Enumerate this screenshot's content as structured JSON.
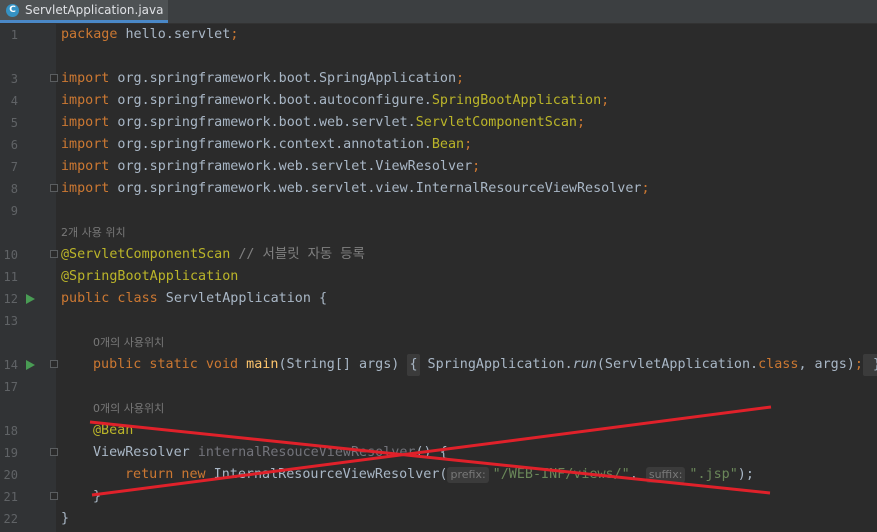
{
  "tab": {
    "icon": "java-class-icon",
    "icon_glyph": "C",
    "label": "ServletApplication.java"
  },
  "lines": {
    "l1": {
      "num": "1",
      "kw": "package",
      "rest": " hello.servlet",
      "semi": ";"
    },
    "l3": {
      "num": "3",
      "kw": "import",
      "rest": " org.springframework.boot.SpringApplication",
      "semi": ";"
    },
    "l4": {
      "num": "4",
      "kw": "import",
      "rest": " org.springframework.boot.autoconfigure.",
      "ann": "SpringBootApplication",
      "semi": ";"
    },
    "l5": {
      "num": "5",
      "kw": "import",
      "rest": " org.springframework.boot.web.servlet.",
      "ann": "ServletComponentScan",
      "semi": ";"
    },
    "l6": {
      "num": "6",
      "kw": "import",
      "rest": " org.springframework.context.annotation.",
      "ann": "Bean",
      "semi": ";"
    },
    "l7": {
      "num": "7",
      "kw": "import",
      "rest": " org.springframework.web.servlet.ViewResolver",
      "semi": ";"
    },
    "l8": {
      "num": "8",
      "kw": "import",
      "rest": " org.springframework.web.servlet.view.InternalResourceViewResolver",
      "semi": ";"
    },
    "l9": {
      "num": "9"
    },
    "hint1": "2개 사용 위치",
    "l10": {
      "num": "10",
      "ann": "@ServletComponentScan",
      "cmt": " // 서블릿 자동 등록"
    },
    "l11": {
      "num": "11",
      "ann": "@SpringBootApplication"
    },
    "l12": {
      "num": "12",
      "kw": "public class",
      "rest": " ServletApplication {"
    },
    "l13": {
      "num": "13"
    },
    "hint2": "0개의 사용위치",
    "l14": {
      "num": "14",
      "kw1": "public static void",
      "fn": " main",
      "p1": "(String[] args) ",
      "b1": "{",
      "p2": " SpringApplication.",
      "run": "run",
      "p3": "(ServletApplication.",
      "kw2": "class",
      "p4": ", args)",
      "semi": ";",
      "b2": " }"
    },
    "l17": {
      "num": "17"
    },
    "hint3": "0개의 사용위치",
    "l18": {
      "num": "18",
      "ann": "@Bean"
    },
    "l19": {
      "num": "19",
      "type": "ViewResolver ",
      "name": "internalResouceViewResolver",
      "rest": "() {"
    },
    "l20": {
      "num": "20",
      "kw": "return new",
      "cls": " InternalResourceViewResolver(",
      "prefix_hint": "prefix:",
      "s1": "\"/WEB-INF/views/\"",
      "comma": ", ",
      "suffix_hint": "suffix:",
      "s2": "\".jsp\"",
      "end": ");"
    },
    "l21": {
      "num": "21",
      "text": "}"
    },
    "l22": {
      "num": "22",
      "text": "}"
    }
  },
  "colors": {
    "background": "#2b2b2b",
    "keyword": "#cc7832",
    "annotation": "#bbb529",
    "string": "#6a8759",
    "strike": "#e0212a"
  }
}
